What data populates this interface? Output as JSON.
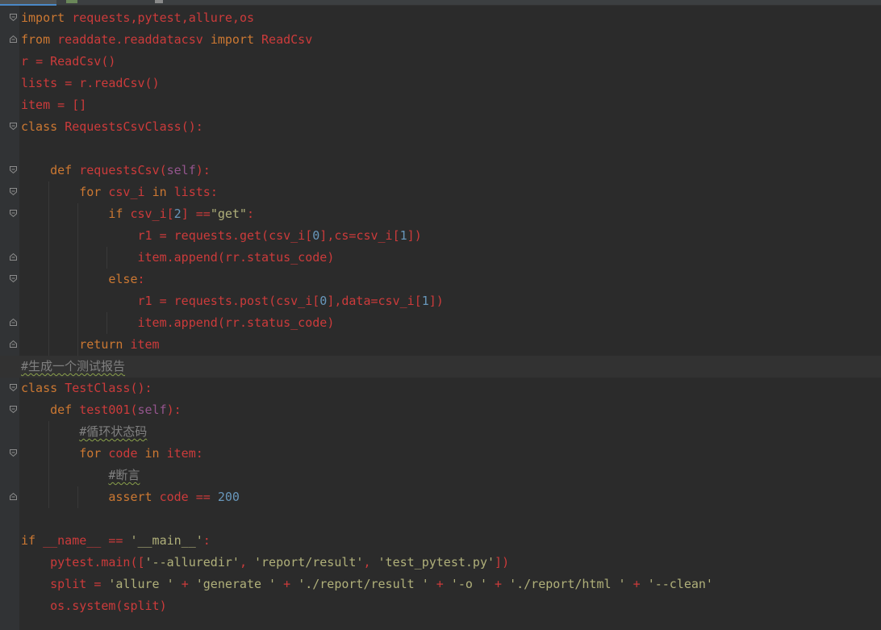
{
  "editor": {
    "lines": [
      "import requests,pytest,allure,os",
      "from readdate.readdatacsv import ReadCsv",
      "r = ReadCsv()",
      "lists = r.readCsv()",
      "item = []",
      "class RequestsCsvClass():",
      "",
      "    def requestsCsv(self):",
      "        for csv_i in lists:",
      "            if csv_i[2] ==\"get\":",
      "                r1 = requests.get(csv_i[0],cs=csv_i[1])",
      "                item.append(rr.status_code)",
      "            else:",
      "                r1 = requests.post(csv_i[0],data=csv_i[1])",
      "                item.append(rr.status_code)",
      "        return item",
      "#生成一个测试报告",
      "class TestClass():",
      "    def test001(self):",
      "        #循环状态码",
      "        for code in item:",
      "            #断言",
      "            assert code == 200",
      "",
      "if __name__ == '__main__':",
      "    pytest.main(['--alluredir', 'report/result', 'test_pytest.py'])",
      "    split = 'allure ' + 'generate ' + './report/result ' + '-o ' + './report/html ' + '--clean'",
      "    os.system(split)"
    ],
    "highlighted_line": 17,
    "colors": {
      "background": "#2b2b2b",
      "gutter": "#313335",
      "keyword": "#cc7832",
      "identifier": "#cc3b3b",
      "number": "#6897bb",
      "string": "#b0b07a",
      "self": "#94558d",
      "comment": "#808080"
    }
  }
}
